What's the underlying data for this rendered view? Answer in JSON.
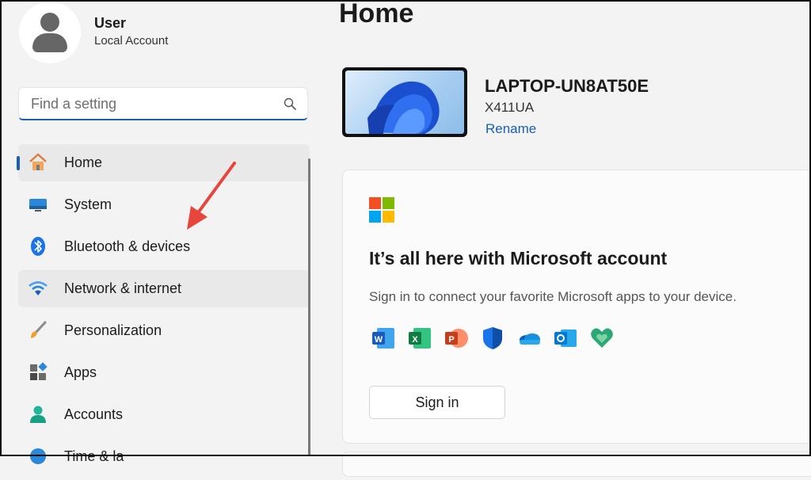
{
  "user": {
    "name": "User",
    "account_type": "Local Account"
  },
  "search": {
    "placeholder": "Find a setting"
  },
  "nav": {
    "items": [
      {
        "label": "Home",
        "icon": "home-icon"
      },
      {
        "label": "System",
        "icon": "monitor-icon"
      },
      {
        "label": "Bluetooth & devices",
        "icon": "bluetooth-icon"
      },
      {
        "label": "Network & internet",
        "icon": "wifi-icon"
      },
      {
        "label": "Personalization",
        "icon": "brush-icon"
      },
      {
        "label": "Apps",
        "icon": "apps-icon"
      },
      {
        "label": "Accounts",
        "icon": "person-icon"
      },
      {
        "label": "Time & la",
        "icon": "clock-icon"
      }
    ],
    "selected": "Home"
  },
  "main": {
    "title": "Home",
    "device": {
      "name": "LAPTOP-UN8AT50E",
      "model": "X411UA",
      "rename_label": "Rename"
    },
    "ms_card": {
      "title": "It’s all here with Microsoft account",
      "description": "Sign in to connect your favorite Microsoft apps to your device.",
      "apps": [
        "word-icon",
        "excel-icon",
        "powerpoint-icon",
        "defender-icon",
        "onedrive-icon",
        "outlook-icon",
        "family-safety-icon"
      ],
      "signin_label": "Sign in"
    }
  },
  "colors": {
    "accent": "#1a5fb4",
    "annotation_arrow": "#e8453c",
    "background": "#f3f3f3"
  }
}
